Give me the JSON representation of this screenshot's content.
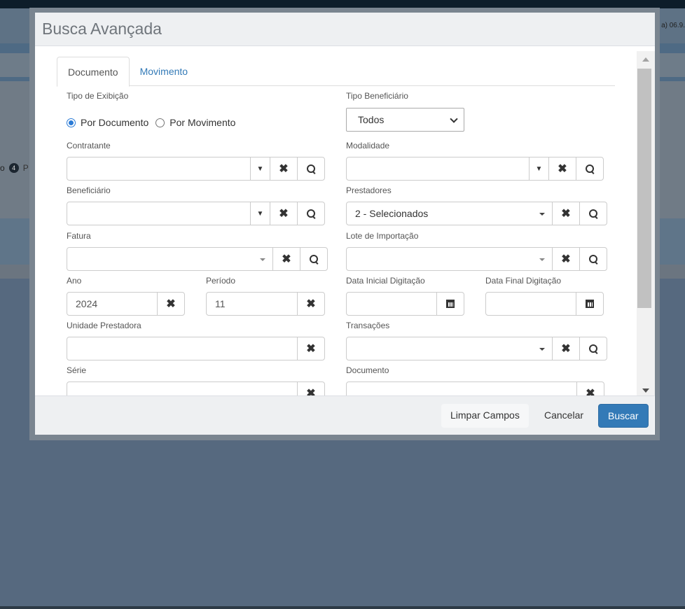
{
  "background": {
    "version_text": "a) 06.9.",
    "step_number": "4",
    "step_text": "P",
    "step_prefix": "o"
  },
  "modal": {
    "title": "Busca Avançada",
    "tabs": [
      {
        "label": "Documento",
        "active": true
      },
      {
        "label": "Movimento",
        "active": false
      }
    ],
    "fields": {
      "tipo_exibicao": {
        "label": "Tipo de Exibição",
        "options": [
          "Por Documento",
          "Por Movimento"
        ],
        "selected": "Por Documento"
      },
      "tipo_beneficiario": {
        "label": "Tipo Beneficiário",
        "value": "Todos"
      },
      "contratante": {
        "label": "Contratante",
        "value": ""
      },
      "modalidade": {
        "label": "Modalidade",
        "value": ""
      },
      "beneficiario": {
        "label": "Beneficiário",
        "value": ""
      },
      "prestadores": {
        "label": "Prestadores",
        "value": "2 - Selecionados"
      },
      "fatura": {
        "label": "Fatura",
        "value": ""
      },
      "lote_importacao": {
        "label": "Lote de Importação",
        "value": ""
      },
      "ano": {
        "label": "Ano",
        "value": "2024"
      },
      "periodo": {
        "label": "Período",
        "value": "11"
      },
      "data_inicial": {
        "label": "Data Inicial Digitação",
        "value": ""
      },
      "data_final": {
        "label": "Data Final Digitação",
        "value": ""
      },
      "unidade_prestadora": {
        "label": "Unidade Prestadora",
        "value": ""
      },
      "transacoes": {
        "label": "Transações",
        "value": ""
      },
      "serie": {
        "label": "Série",
        "value": ""
      },
      "documento": {
        "label": "Documento",
        "value": ""
      }
    },
    "footer": {
      "clear_label": "Limpar Campos",
      "cancel_label": "Cancelar",
      "search_label": "Buscar"
    }
  },
  "colors": {
    "primary": "#337ab7",
    "backdrop": "#56697f",
    "header_bg": "#eef0f2"
  }
}
